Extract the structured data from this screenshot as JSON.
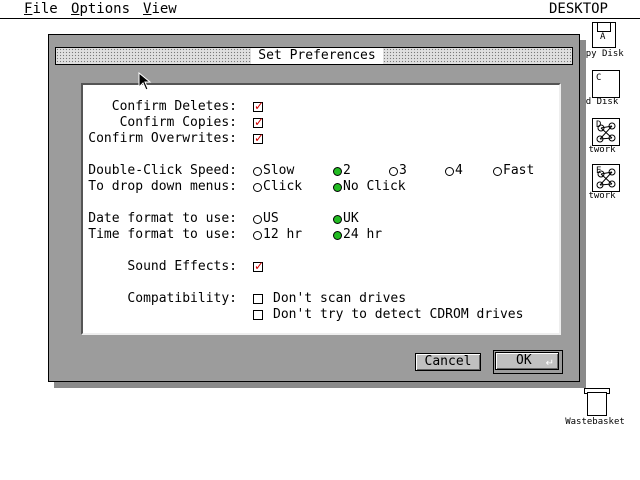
{
  "menubar": {
    "items": [
      {
        "label": "File",
        "hotkey": "F"
      },
      {
        "label": "Options",
        "hotkey": "O"
      },
      {
        "label": "View",
        "hotkey": "V"
      }
    ],
    "app_title": "DESKTOP"
  },
  "desktop_icons": [
    {
      "label": "ppy Disk",
      "icon": "floppy-disk-icon",
      "glyph_text": "A"
    },
    {
      "label": "d Disk",
      "icon": "hard-disk-icon",
      "glyph_text": "C"
    },
    {
      "label": "twork",
      "icon": "network-icon",
      "glyph_text": "D"
    },
    {
      "label": "twork",
      "icon": "network-icon",
      "glyph_text": "E"
    }
  ],
  "wastebasket": {
    "label": "Wastebasket",
    "icon": "wastebasket-icon"
  },
  "dialog": {
    "title": "Set Preferences",
    "confirm": {
      "deletes": {
        "label": "Confirm Deletes:",
        "checked": true
      },
      "copies": {
        "label": "Confirm Copies:",
        "checked": true
      },
      "overwrites": {
        "label": "Confirm Overwrites:",
        "checked": true
      }
    },
    "double_click_speed": {
      "label": "Double-Click Speed:",
      "options": [
        "Slow",
        "2",
        "3",
        "4",
        "Fast"
      ],
      "selected": "2"
    },
    "drop_down_menus": {
      "label": "To drop down menus:",
      "options": [
        "Click",
        "No Click"
      ],
      "selected": "No Click"
    },
    "date_format": {
      "label": "Date format to use:",
      "options": [
        "US",
        "UK"
      ],
      "selected": "UK"
    },
    "time_format": {
      "label": "Time format to use:",
      "options": [
        "12 hr",
        "24 hr"
      ],
      "selected": "24 hr"
    },
    "sound_effects": {
      "label": "Sound Effects:",
      "checked": true
    },
    "compatibility": {
      "label": "Compatibility:",
      "options": [
        {
          "label": "Don't scan drives",
          "checked": false
        },
        {
          "label": "Don't try to detect CDROM drives",
          "checked": false
        }
      ]
    },
    "buttons": {
      "cancel": "Cancel",
      "ok": "OK",
      "ok_glyph": "↵"
    }
  },
  "colors": {
    "dialog_bg": "#9c9c9c",
    "check_red": "#d00000",
    "radio_green": "#22bb22",
    "panel_bg": "#ffffff"
  }
}
